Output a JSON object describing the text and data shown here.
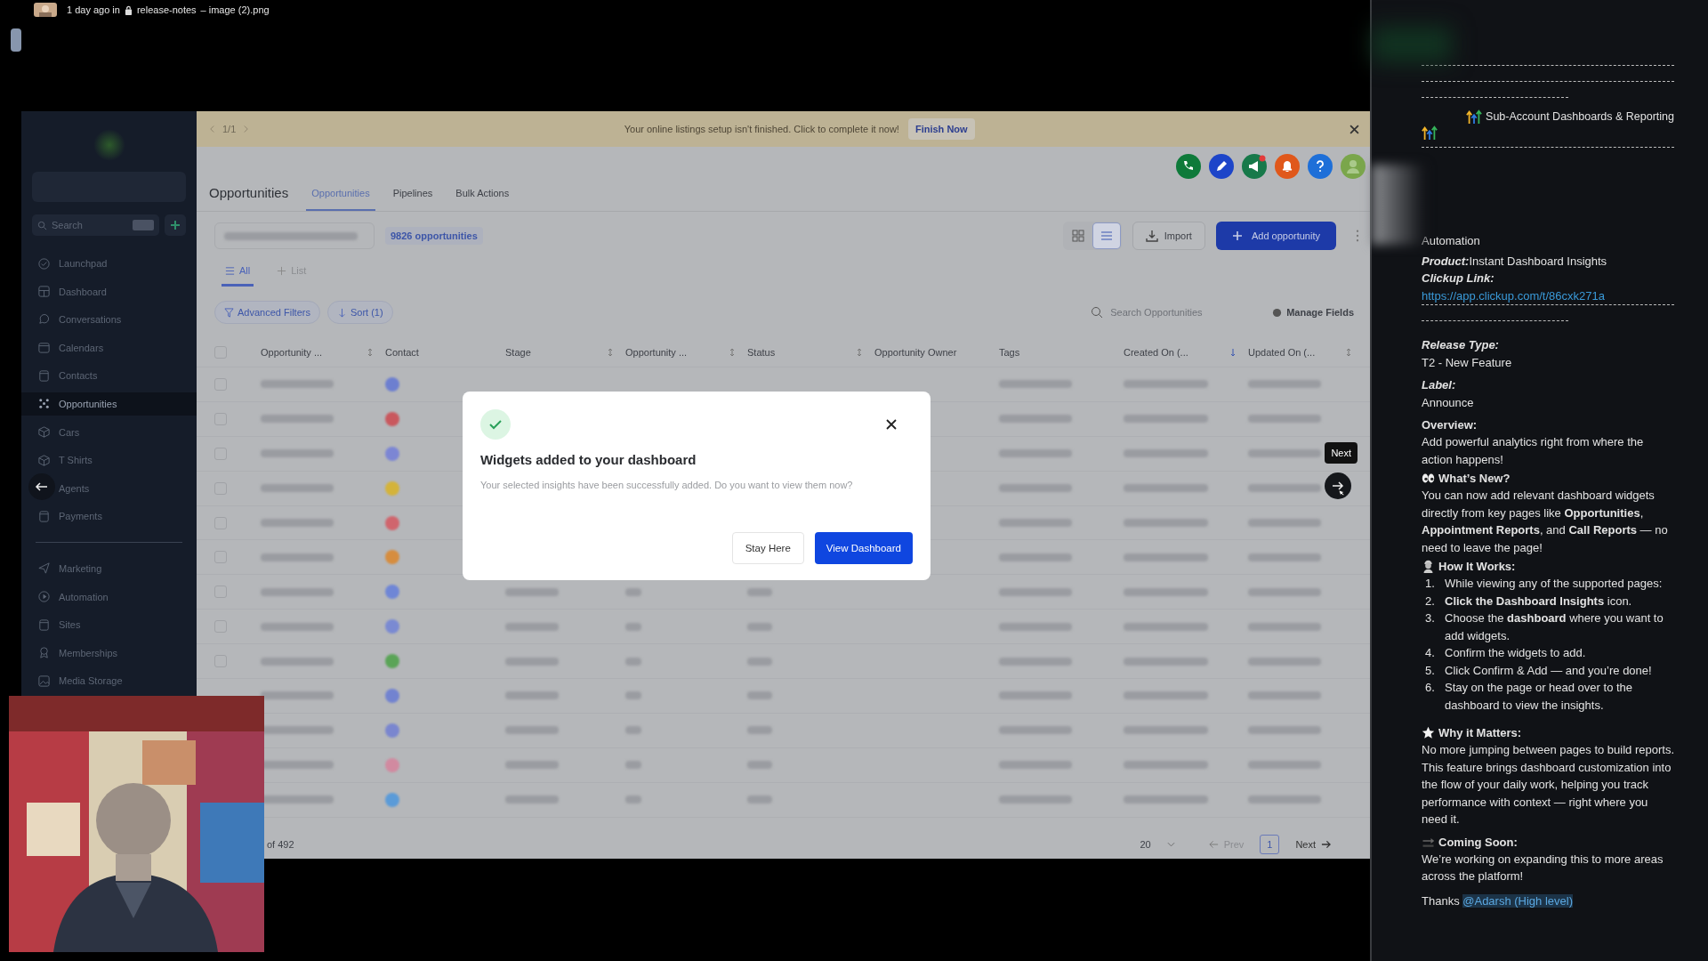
{
  "post_meta": {
    "time": "1 day ago in",
    "channel": "release-notes",
    "file": "– image (2).png"
  },
  "app": {
    "sidebar": {
      "search_placeholder": "Search",
      "items": [
        {
          "label": "Launchpad",
          "selected": false
        },
        {
          "label": "Dashboard",
          "selected": false
        },
        {
          "label": "Conversations",
          "selected": false
        },
        {
          "label": "Calendars",
          "selected": false
        },
        {
          "label": "Contacts",
          "selected": false
        },
        {
          "label": "Opportunities",
          "selected": true
        },
        {
          "label": "Cars",
          "selected": false
        },
        {
          "label": "T Shirts",
          "selected": false
        },
        {
          "label": "Agents",
          "selected": false
        },
        {
          "label": "Payments",
          "selected": false
        }
      ],
      "items_bottom": [
        {
          "label": "Marketing",
          "selected": false
        },
        {
          "label": "Automation",
          "selected": false
        },
        {
          "label": "Sites",
          "selected": false
        },
        {
          "label": "Memberships",
          "selected": false
        },
        {
          "label": "Media Storage",
          "selected": false
        }
      ]
    },
    "banner": {
      "pager": "1/1",
      "message": "Your online listings setup isn't finished. Click to complete it now!",
      "action": "Finish Now"
    },
    "header_icons": [
      {
        "kind": "phone",
        "color": "#0e7a3a"
      },
      {
        "kind": "edit",
        "color": "#1d45c9"
      },
      {
        "kind": "megaphone",
        "color": "#17794a"
      },
      {
        "kind": "bell",
        "color": "#e0581b"
      },
      {
        "kind": "help",
        "color": "#1e6fd8"
      },
      {
        "kind": "avatar",
        "color": "#7aa64b"
      }
    ],
    "title": "Opportunities",
    "tabs": [
      {
        "label": "Opportunities",
        "selected": true
      },
      {
        "label": "Pipelines",
        "selected": false
      },
      {
        "label": "Bulk Actions",
        "selected": false
      }
    ],
    "count_badge": "9826 opportunities",
    "view_modes": [
      {
        "kind": "grid",
        "selected": false
      },
      {
        "kind": "list",
        "selected": true
      }
    ],
    "import_button": "Import",
    "add_button": "Add opportunity",
    "view_tabs": [
      {
        "kind": "all",
        "label": "All",
        "selected": true
      },
      {
        "kind": "add",
        "label": "List",
        "selected": false
      }
    ],
    "filters": [
      {
        "kind": "filter",
        "label": "Advanced Filters"
      },
      {
        "kind": "sort",
        "label": "Sort (1)"
      }
    ],
    "search_placeholder": "Search Opportunities",
    "manage_fields": "Manage Fields",
    "select_all": {
      "checked": false
    },
    "columns": [
      {
        "label": "Opportunity ..."
      },
      {
        "label": "Contact"
      },
      {
        "label": "Stage"
      },
      {
        "label": "Opportunity ..."
      },
      {
        "label": "Status"
      },
      {
        "label": "Opportunity Owner"
      },
      {
        "label": "Tags"
      },
      {
        "label": "Created On (..."
      },
      {
        "label": "Updated On (..."
      }
    ],
    "rows": [
      {
        "checked": false,
        "color": "#6d7fd0"
      },
      {
        "checked": false,
        "color": "#c9585e"
      },
      {
        "checked": false,
        "color": "#7c86d4"
      },
      {
        "checked": false,
        "color": "#d4b33a"
      },
      {
        "checked": false,
        "color": "#d0656d"
      },
      {
        "checked": false,
        "color": "#d68d3f"
      },
      {
        "checked": false,
        "color": "#6f86d6"
      },
      {
        "checked": false,
        "color": "#7a8ad2"
      },
      {
        "checked": false,
        "color": "#5aa457"
      },
      {
        "color": "#7283d0"
      },
      {
        "color": "#7a86cf"
      },
      {
        "color": "#d18aa0"
      },
      {
        "color": "#5b9bd8"
      }
    ],
    "pagination": {
      "range": "of 492",
      "page_size": "20",
      "prev": "Prev",
      "page": "1",
      "next": "Next"
    }
  },
  "modal": {
    "title": "Widgets added to your dashboard",
    "body": "Your selected insights have been successfully added. Do you want to view them now?",
    "secondary": "Stay Here",
    "primary": "View Dashboard"
  },
  "tour": {
    "tooltip": "Next"
  },
  "release_note": [
    {
      "kind": "rule"
    },
    {
      "kind": "rule"
    },
    {
      "kind": "short_rule"
    },
    {
      "kind": "title",
      "text": "Sub-Account Dashboards & Reporting"
    },
    {
      "kind": "rule"
    },
    {
      "kind": "blurred"
    },
    {
      "kind": "text",
      "text": "Automation"
    },
    {
      "kind": "field",
      "label": "Product:",
      "value": "Instant Dashboard Insights"
    },
    {
      "kind": "field",
      "label": "Clickup Link:"
    },
    {
      "kind": "link",
      "text": "https://app.clickup.com/t/86cxk271a"
    },
    {
      "kind": "rule"
    },
    {
      "kind": "short_rule"
    },
    {
      "kind": "stacked",
      "label": "Release Type:",
      "value": "T2 - New Feature"
    },
    {
      "kind": "stacked",
      "label": "Label:",
      "value": "Announce"
    },
    {
      "kind": "section",
      "label": "Overview:",
      "value": "Add powerful analytics right from where the action happens!"
    },
    {
      "kind": "section",
      "label": "What’s New?",
      "value": "You can now add relevant dashboard widgets directly from key pages like **Opportunities**, **Appointment Reports**, and **Call Reports** — no need to leave the page!"
    },
    {
      "kind": "steps",
      "label": "How It Works:",
      "steps": [
        {
          "number": "1.",
          "text": "While viewing any of the supported pages:"
        },
        {
          "number": "2.",
          "text": "**Click the Dashboard Insights** icon."
        },
        {
          "number": "3.",
          "text": "Choose the **dashboard** where you want to add widgets."
        },
        {
          "number": "4.",
          "text": "Confirm the widgets to add."
        },
        {
          "number": "5.",
          "text": "Click Confirm & Add — and you’re done!"
        },
        {
          "number": "6.",
          "text": "Stay on the page or head over to the dashboard to view the insights."
        }
      ]
    },
    {
      "kind": "section",
      "label": "Why it Matters:",
      "value": "No more jumping between pages to build reports. This feature brings dashboard customization into the flow of your daily work, helping you track performance with context — right where you need it."
    },
    {
      "kind": "section",
      "label": "Coming Soon:",
      "value": "We’re working on expanding this to more areas across the platform!"
    },
    {
      "kind": "mention",
      "text": "Thanks",
      "mention": "@Adarsh (High level)"
    }
  ]
}
